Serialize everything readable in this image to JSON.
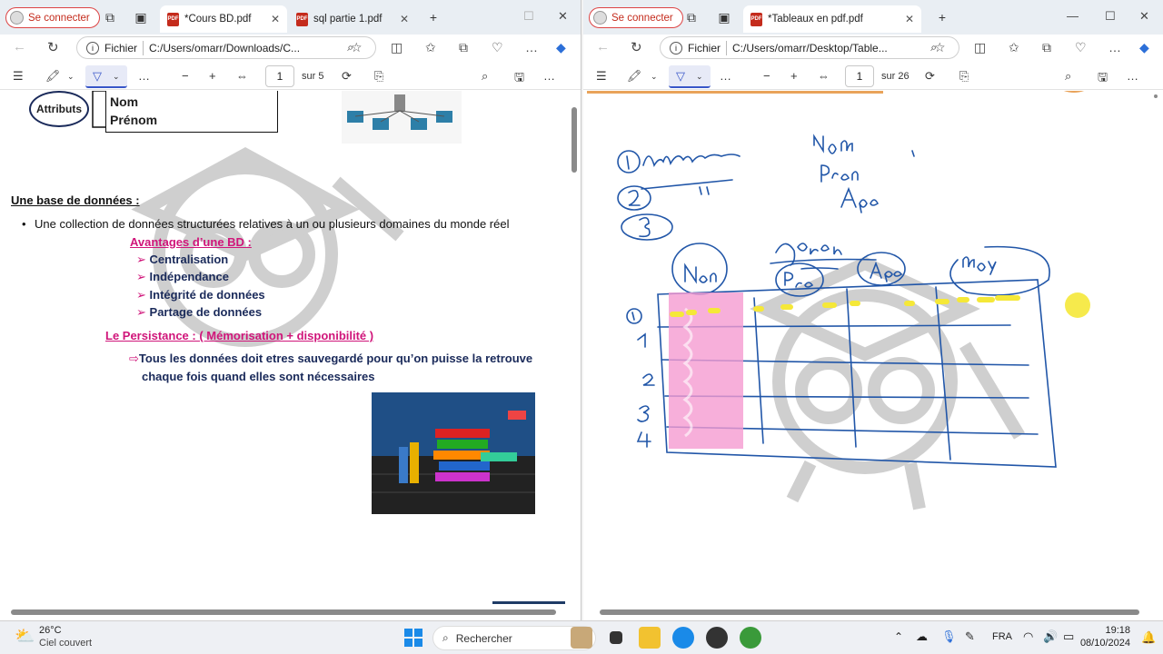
{
  "left_window": {
    "signin": "Se connecter",
    "tabs": [
      {
        "title": "*Cours BD.pdf",
        "active": true
      },
      {
        "title": "sql partie 1.pdf",
        "active": false
      }
    ],
    "url_label": "Fichier",
    "url": "C:/Users/omarr/Downloads/C...",
    "page_current": "1",
    "page_total": "sur 5",
    "doc": {
      "attr_circle": "Attributs",
      "field_nom": "Nom",
      "field_prenom": "Prénom",
      "heading": "Une base de données :",
      "bullet": "Une collection de données structurées relatives à un ou plusieurs domaines du monde réel",
      "advantages_title": "Avantages d’une BD :",
      "advantages": [
        "Centralisation",
        "Indépendance",
        "Intégrité de données",
        "Partage de données"
      ],
      "persistence_title": "Le Persistance : ( Mémorisation + disponibilité )",
      "persistence_line1": "Tous les données doit etres sauvegardé pour qu’on puisse la retrouve",
      "persistence_line2": "chaque fois quand elles sont nécessaires"
    }
  },
  "right_window": {
    "signin": "Se connecter",
    "tabs": [
      {
        "title": "*Tableaux en pdf.pdf",
        "active": true
      }
    ],
    "url_label": "Fichier",
    "url": "C:/Users/omarr/Desktop/Table...",
    "page_current": "1",
    "page_total": "sur 26"
  },
  "taskbar": {
    "weather_temp": "26°C",
    "weather_desc": "Ciel couvert",
    "search_placeholder": "Rechercher",
    "lang": "FRA",
    "time": "19:18",
    "date": "08/10/2024"
  }
}
